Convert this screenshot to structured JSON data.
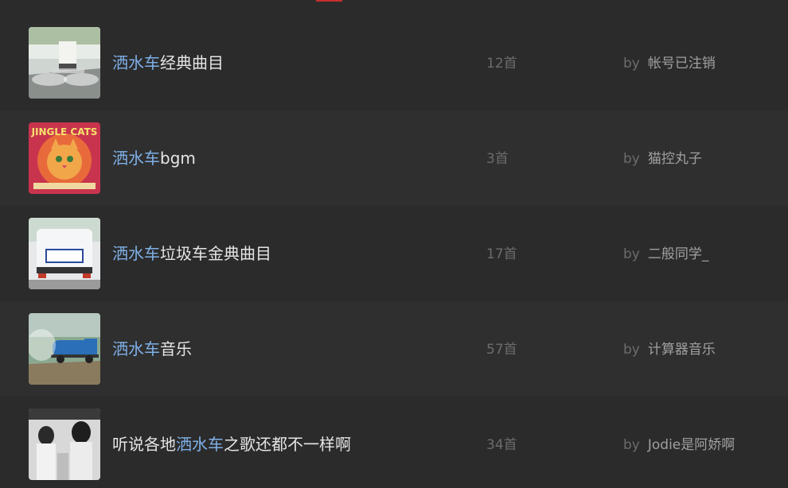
{
  "colors": {
    "background": "#2b2b2b",
    "row_alt": "#2f2f2f",
    "highlight": "#7fb0e8",
    "title": "#e5e5e5",
    "muted": "#6c6c6c",
    "owner": "#a0a0a0",
    "accent": "#c62f2f"
  },
  "playlists": [
    {
      "cover": "cover-road-sprinkler-truck",
      "title_pre": "",
      "title_hl": "洒水车",
      "title_post": "经典曲目",
      "count": "12首",
      "by": "by",
      "owner": "帐号已注销"
    },
    {
      "cover": "cover-jingle-cats-album",
      "title_pre": "",
      "title_hl": "洒水车",
      "title_post": "bgm",
      "count": "3首",
      "by": "by",
      "owner": "猫控丸子"
    },
    {
      "cover": "cover-truck-rear",
      "title_pre": "",
      "title_hl": "洒水车",
      "title_post": "垃圾车金典曲目",
      "count": "17首",
      "by": "by",
      "owner": "二般同学_"
    },
    {
      "cover": "cover-blue-sprinkler-truck",
      "title_pre": "",
      "title_hl": "洒水车",
      "title_post": "音乐",
      "count": "57首",
      "by": "by",
      "owner": "计算器音乐"
    },
    {
      "cover": "cover-group-photo-bw",
      "title_pre": "听说各地",
      "title_hl": "洒水车",
      "title_post": "之歌还都不一样啊",
      "count": "34首",
      "by": "by",
      "owner": "Jodie是阿娇啊"
    }
  ]
}
